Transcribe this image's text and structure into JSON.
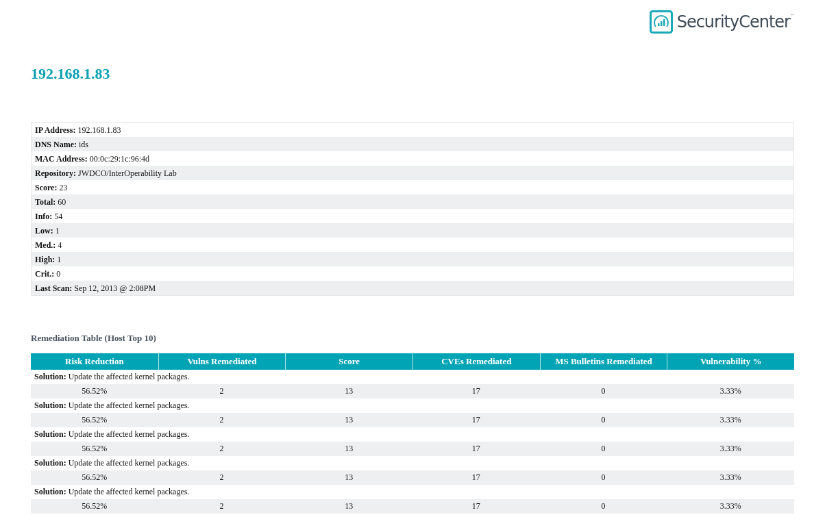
{
  "logo": {
    "name": "SecurityCenter",
    "mark": "™"
  },
  "title": "192.168.1.83",
  "info_rows": [
    "**IP Address:** 192.168.1.83",
    "**DNS Name:** ids",
    "**MAC Address:** 00:0c:29:1c:96:4d",
    "**Repository:** JWDCO/InterOperability Lab",
    "**Score:** 23",
    "**Total:** 60",
    "**Info:** 54",
    "**Low:** 1",
    "**Med.:** 4",
    "**High:** 1",
    "**Crit.:** 0",
    "**Last Scan:** Sep 12, 2013 @ 2:08PM"
  ],
  "remediation_table": {
    "title": "Remediation Table (Host Top 10)",
    "columns": [
      "Risk Reduction",
      "Vulns Remediated",
      "Score",
      "CVEs Remediated",
      "MS Bulletins Remediated",
      "Vulnerability %"
    ],
    "entries": [
      {
        "solution": "**Solution:** Update the affected kernel packages.",
        "cells": [
          "56.52%",
          "2",
          "13",
          "17",
          "0",
          "3.33%"
        ]
      },
      {
        "solution": "**Solution:** Update the affected kernel packages.",
        "cells": [
          "56.52%",
          "2",
          "13",
          "17",
          "0",
          "3.33%"
        ]
      },
      {
        "solution": "**Solution:** Update the affected kernel packages.",
        "cells": [
          "56.52%",
          "2",
          "13",
          "17",
          "0",
          "3.33%"
        ]
      },
      {
        "solution": "**Solution:** Update the affected kernel packages.",
        "cells": [
          "56.52%",
          "2",
          "13",
          "17",
          "0",
          "3.33%"
        ]
      },
      {
        "solution": "**Solution:** Update the affected kernel packages.",
        "cells": [
          "56.52%",
          "2",
          "13",
          "17",
          "0",
          "3.33%"
        ]
      }
    ]
  }
}
